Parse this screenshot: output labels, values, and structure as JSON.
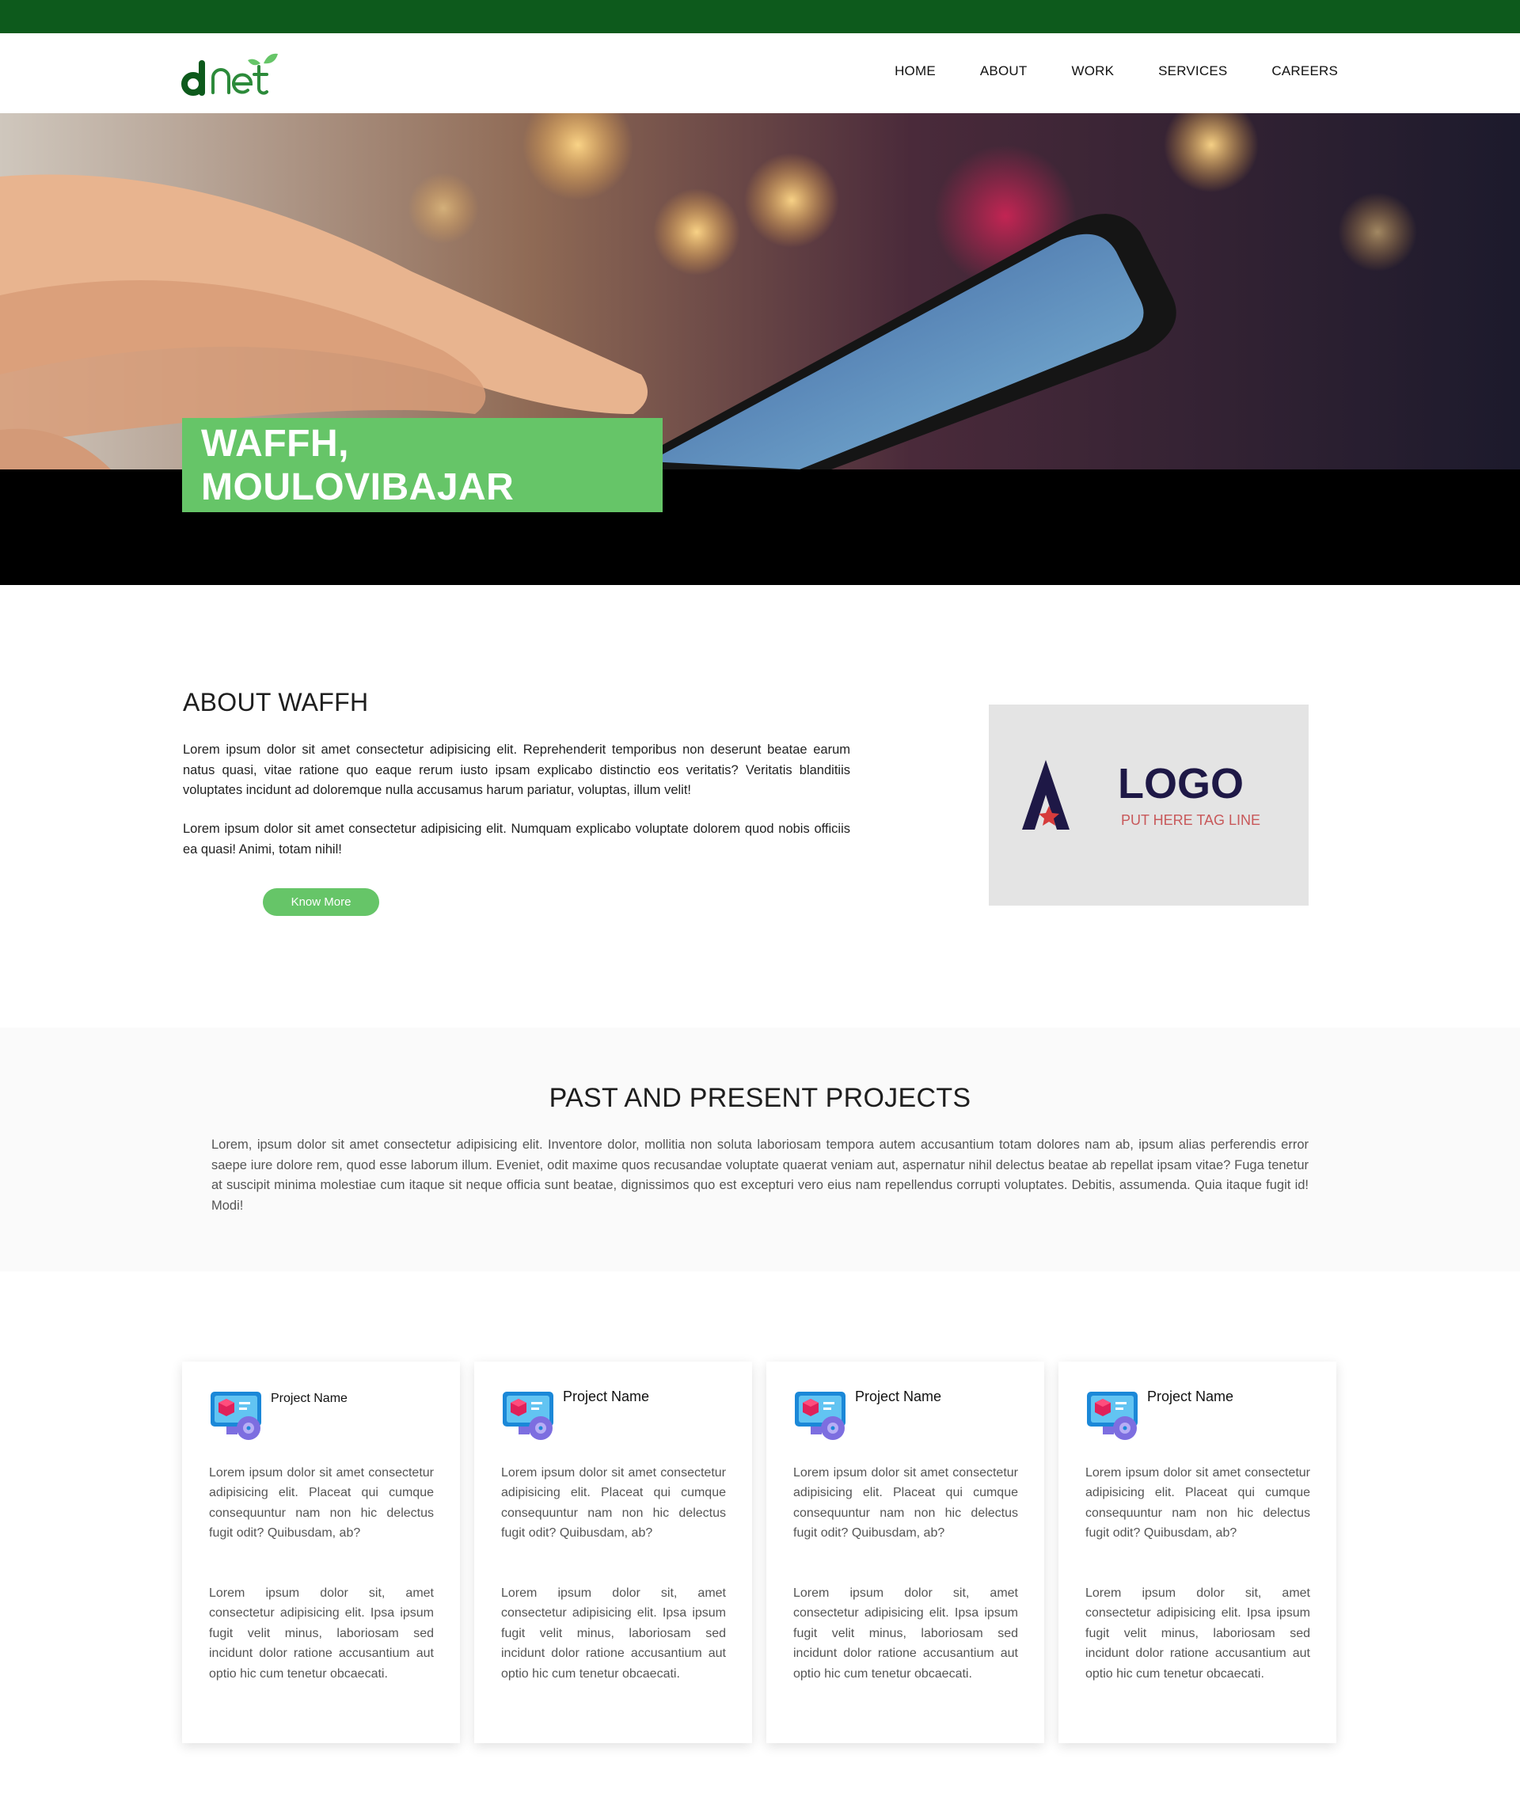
{
  "brand": {
    "logo_text": "dnet",
    "primary_color": "#66c568",
    "top_bar_color": "#0d5a1c"
  },
  "nav": {
    "items": [
      {
        "label": "HOME"
      },
      {
        "label": "ABOUT"
      },
      {
        "label": "WORK"
      },
      {
        "label": "SERVICES"
      },
      {
        "label": "CAREERS"
      }
    ]
  },
  "hero": {
    "title": "WAFFH, MOULOVIBAJAR"
  },
  "about": {
    "heading": "ABOUT WAFFH",
    "paragraph_1": "Lorem ipsum dolor sit amet consectetur adipisicing elit. Reprehenderit temporibus non deserunt beatae earum natus quasi, vitae ratione quo eaque rerum iusto ipsam explicabo distinctio eos veritatis? Veritatis blanditiis voluptates incidunt ad doloremque nulla accusamus harum pariatur, voluptas, illum velit!",
    "paragraph_2": "Lorem ipsum dolor sit amet consectetur adipisicing elit. Numquam explicabo voluptate dolorem quod nobis officiis ea quasi! Animi, totam nihil!",
    "button_label": "Know More",
    "logo_text": "LOGO",
    "logo_tagline": "PUT HERE TAG LINE"
  },
  "projects": {
    "heading": "PAST AND PRESENT PROJECTS",
    "description": "Lorem, ipsum dolor sit amet consectetur adipisicing elit. Inventore dolor, mollitia non soluta laboriosam tempora autem accusantium totam dolores nam ab, ipsum alias perferendis error saepe iure dolore rem, quod esse laborum illum. Eveniet, odit maxime quos recusandae voluptate quaerat veniam aut, aspernatur nihil delectus beatae ab repellat ipsam vitae? Fuga tenetur at suscipit minima molestiae cum itaque sit neque officia sunt beatae, dignissimos quo est excepturi vero eius nam repellendus corrupti voluptates. Debitis, assumenda. Quia itaque fugit id! Modi!",
    "cards": [
      {
        "title": "Project Name",
        "icon": "monitor-cube-icon",
        "text_1": "Lorem ipsum dolor sit amet consectetur adipisicing elit. Placeat qui cumque consequuntur nam non hic delectus fugit odit? Quibusdam, ab?",
        "text_2": "Lorem ipsum dolor sit, amet consectetur adipisicing elit. Ipsa ipsum fugit velit minus, laboriosam sed incidunt dolor ratione accusantium aut optio hic cum tenetur obcaecati."
      },
      {
        "title": "Project Name",
        "icon": "monitor-cube-icon",
        "text_1": "Lorem ipsum dolor sit amet consectetur adipisicing elit. Placeat qui cumque consequuntur nam non hic delectus fugit odit? Quibusdam, ab?",
        "text_2": "Lorem ipsum dolor sit, amet consectetur adipisicing elit. Ipsa ipsum fugit velit minus, laboriosam sed incidunt dolor ratione accusantium aut optio hic cum tenetur obcaecati."
      },
      {
        "title": "Project Name",
        "icon": "monitor-cube-icon",
        "text_1": "Lorem ipsum dolor sit amet consectetur adipisicing elit. Placeat qui cumque consequuntur nam non hic delectus fugit odit? Quibusdam, ab?",
        "text_2": "Lorem ipsum dolor sit, amet consectetur adipisicing elit. Ipsa ipsum fugit velit minus, laboriosam sed incidunt dolor ratione accusantium aut optio hic cum tenetur obcaecati."
      },
      {
        "title": "Project Name",
        "icon": "monitor-cube-icon",
        "text_1": "Lorem ipsum dolor sit amet consectetur adipisicing elit. Placeat qui cumque consequuntur nam non hic delectus fugit odit? Quibusdam, ab?",
        "text_2": "Lorem ipsum dolor sit, amet consectetur adipisicing elit. Ipsa ipsum fugit velit minus, laboriosam sed incidunt dolor ratione accusantium aut optio hic cum tenetur obcaecati."
      }
    ]
  }
}
